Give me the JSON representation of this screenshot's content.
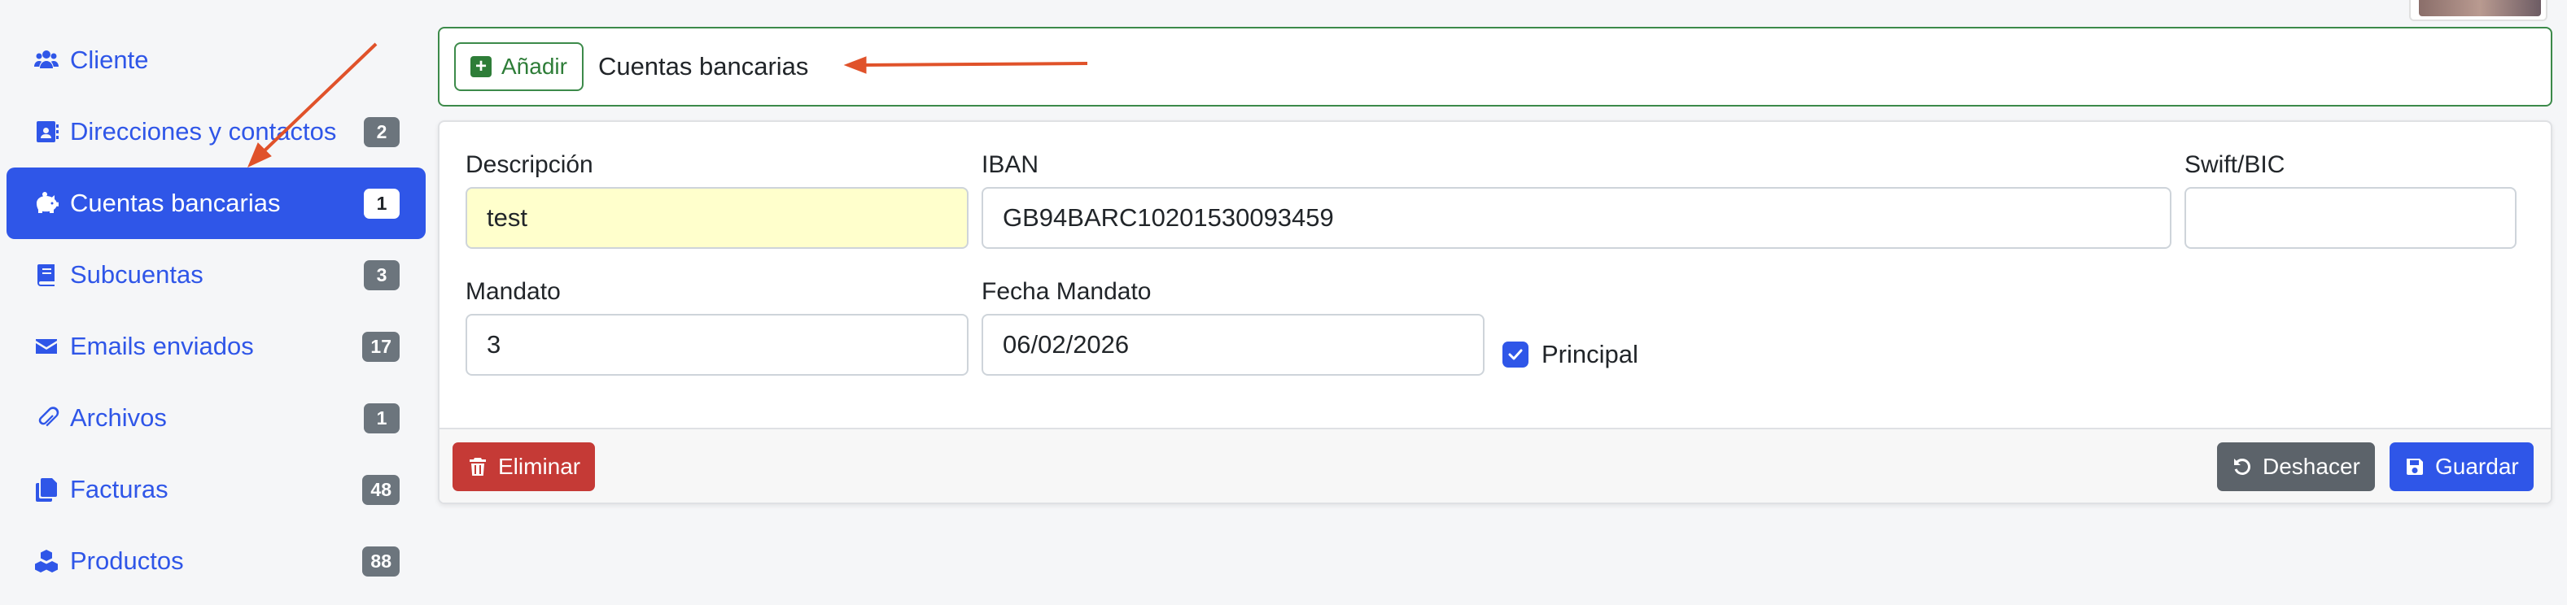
{
  "sidebar": {
    "items": [
      {
        "label": "Cliente",
        "icon": "users-icon",
        "badge": ""
      },
      {
        "label": "Direcciones y contactos",
        "icon": "address-book-icon",
        "badge": "2"
      },
      {
        "label": "Cuentas bancarias",
        "icon": "piggy-bank-icon",
        "badge": "1",
        "active": true
      },
      {
        "label": "Subcuentas",
        "icon": "book-icon",
        "badge": "3"
      },
      {
        "label": "Emails enviados",
        "icon": "envelope-icon",
        "badge": "17"
      },
      {
        "label": "Archivos",
        "icon": "paperclip-icon",
        "badge": "1"
      },
      {
        "label": "Facturas",
        "icon": "copy-icon",
        "badge": "48"
      },
      {
        "label": "Productos",
        "icon": "cubes-icon",
        "badge": "88"
      }
    ]
  },
  "topbar": {
    "add_label": "Añadir",
    "title": "Cuentas bancarias"
  },
  "form": {
    "descripcion_label": "Descripción",
    "descripcion_value": "test",
    "iban_label": "IBAN",
    "iban_value": "GB94BARC10201530093459",
    "swift_label": "Swift/BIC",
    "swift_value": "",
    "mandato_label": "Mandato",
    "mandato_value": "3",
    "fecha_label": "Fecha Mandato",
    "fecha_value": "06/02/2026",
    "principal_label": "Principal",
    "principal_checked": true
  },
  "footer": {
    "delete_label": "Eliminar",
    "undo_label": "Deshacer",
    "save_label": "Guardar"
  },
  "colors": {
    "primary": "#2f56e8",
    "success": "#3c8a4a",
    "danger": "#c53a36",
    "secondary": "#5c636a",
    "annotation_arrow": "#e0522a"
  }
}
